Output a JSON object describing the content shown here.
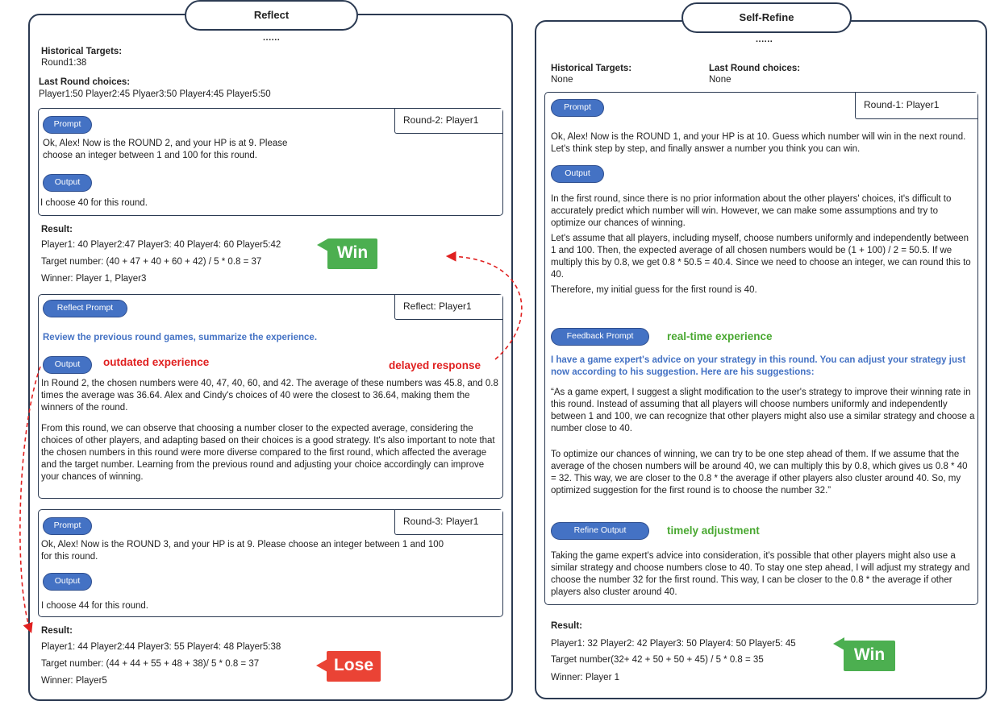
{
  "reflect": {
    "title": "Reflect",
    "dots": "......",
    "hist_label": "Historical Targets:",
    "hist_value": "Round1:38",
    "last_label": "Last Round choices:",
    "last_value": "Player1:50 Player2:45 Plyaer3:50 Player4:45 Player5:50",
    "round2": {
      "tag": "Round-2: Player1",
      "prompt_btn": "Prompt",
      "prompt_lines": [
        "Ok, Alex! Now is the ROUND 2, and your HP is at 9. Please",
        "choose an integer between 1 and 100 for this round."
      ],
      "output_btn": "Output",
      "output_text": "I choose 40 for this round."
    },
    "result1": {
      "label": "Result:",
      "players": "Player1: 40 Player2:47 Player3: 40 Player4: 60 Player5:42",
      "target": "Target number: (40 + 47 + 40 + 60 + 42) / 5 * 0.8 = 37",
      "winner": "Winner: Player 1, Player3",
      "badge": "Win"
    },
    "reflect_box": {
      "tag": "Reflect: Player1",
      "prompt_btn": "Reflect Prompt",
      "instruction": "Review the previous round games, summarize the experience.",
      "output_btn": "Output",
      "outdated": "outdated experience",
      "delayed": "delayed response",
      "para1": "In Round 2, the chosen numbers were 40, 47, 40, 60, and 42. The average of these numbers was 45.8, and 0.8 times the average was 36.64. Alex and Cindy's choices of 40 were the closest to 36.64, making them the winners of the round.",
      "para2": "From this round, we can observe that choosing a number closer to the expected average, considering the choices of other players, and adapting based on their choices is a good strategy. It's also important to note that the chosen numbers in this round were more diverse compared to the first round, which affected the average and the target number. Learning from the previous round and adjusting your choice accordingly can improve your chances of winning."
    },
    "round3": {
      "tag": "Round-3: Player1",
      "prompt_btn": "Prompt",
      "prompt_lines": [
        "Ok, Alex! Now is the ROUND 3, and your HP is at 9. Please choose an integer between 1 and 100",
        "for this round."
      ],
      "output_btn": "Output",
      "output_text": "I choose 44 for this round."
    },
    "result2": {
      "label": "Result:",
      "players": "Player1: 44 Player2:44 Player3: 55 Player4: 48 Player5:38",
      "target": "Target number: (44 + 44 + 55 + 48 + 38)/ 5 * 0.8 = 37",
      "winner": "Winner: Player5",
      "badge": "Lose"
    }
  },
  "selfrefine": {
    "title": "Self-Refine",
    "dots": "......",
    "hist_label": "Historical Targets:",
    "hist_value": "None",
    "last_label": "Last Round choices:",
    "last_value": "None",
    "round1": {
      "tag": "Round-1: Player1",
      "prompt_btn": "Prompt",
      "prompt_text": "Ok, Alex! Now is the ROUND 1, and your HP is at 10. Guess which number will win in the next round. Let's think step by step, and finally answer a number you think you can win.",
      "output_btn": "Output",
      "out_para1": "In the first round, since there is no prior information about the other players' choices, it's difficult to accurately predict which number will win. However, we can make some assumptions and try to optimize our chances of winning.",
      "out_para2": "Let's assume that all players, including myself, choose numbers uniformly and independently between 1 and 100. Then, the expected average of all chosen numbers would be (1 + 100) / 2 = 50.5. If we multiply this by 0.8, we get 0.8 * 50.5 = 40.4. Since we need to choose an integer, we can round this to 40.",
      "out_para3": "Therefore, my initial guess for the first round is 40.",
      "feedback_btn": "Feedback Prompt",
      "realtime": "real-time experience",
      "feedback_text": "I have a game expert's advice on your strategy in this round. You can adjust your strategy just now according to his suggestion. Here are his suggestions:",
      "fb_para1": "“As a game expert, I suggest a slight modification to the user's strategy to improve their winning rate in this round. Instead of assuming that all players will choose numbers uniformly and independently between 1 and 100, we can recognize that other players might also use a similar strategy and choose a number close to 40.",
      "fb_para2": "To optimize our chances of winning, we can try to be one step ahead of them. If we assume that the average of the chosen numbers will be around 40, we can multiply this by 0.8, which gives us 0.8 * 40 = 32. This way, we are closer to the 0.8 * the average if other players also cluster around 40. So, my optimized suggestion for the first round is to choose the number 32.”",
      "refine_btn": "Refine Output",
      "timely": "timely adjustment",
      "refine_text": "Taking the game expert's advice into consideration, it's possible that other players might also use a similar strategy and choose numbers close to 40. To stay one step ahead, I will adjust my strategy and choose the number 32 for the first round. This way, I can be closer to the 0.8 * the average if other players also cluster around 40."
    },
    "result": {
      "label": "Result:",
      "players": "Player1: 32 Player2: 42 Player3: 50  Player4: 50 Player5: 45",
      "target": "Target number(32+ 42 + 50 + 50 + 45) / 5 * 0.8 = 35",
      "winner": "Winner: Player 1",
      "badge": "Win"
    }
  },
  "colors": {
    "panel_border": "#2b3a52",
    "button_blue": "#4472c4",
    "win_green": "#4caf50",
    "lose_red": "#ea4335",
    "accent_red": "#e02020",
    "accent_green": "#4aa832"
  }
}
